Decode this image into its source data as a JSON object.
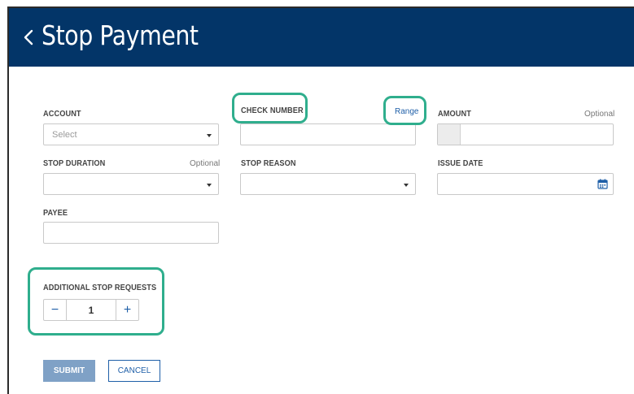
{
  "header": {
    "title": "Stop Payment",
    "back_icon": "chevron-left-icon",
    "background": "#033568"
  },
  "form": {
    "account": {
      "label": "ACCOUNT",
      "placeholder": "Select"
    },
    "check_number": {
      "label": "CHECK NUMBER",
      "range_link": "Range"
    },
    "amount": {
      "label": "AMOUNT",
      "optional": "Optional"
    },
    "stop_duration": {
      "label": "STOP DURATION",
      "optional": "Optional"
    },
    "stop_reason": {
      "label": "STOP REASON"
    },
    "issue_date": {
      "label": "ISSUE DATE",
      "icon": "calendar-icon"
    },
    "payee": {
      "label": "PAYEE"
    },
    "additional_stop_requests": {
      "label": "ADDITIONAL STOP REQUESTS",
      "value": "1",
      "minus": "−",
      "plus": "+"
    }
  },
  "actions": {
    "submit_label": "SUBMIT",
    "cancel_label": "CANCEL"
  },
  "colors": {
    "highlight": "#2fae8d",
    "link": "#1f5fa8",
    "submit": "#7fa1c6"
  }
}
